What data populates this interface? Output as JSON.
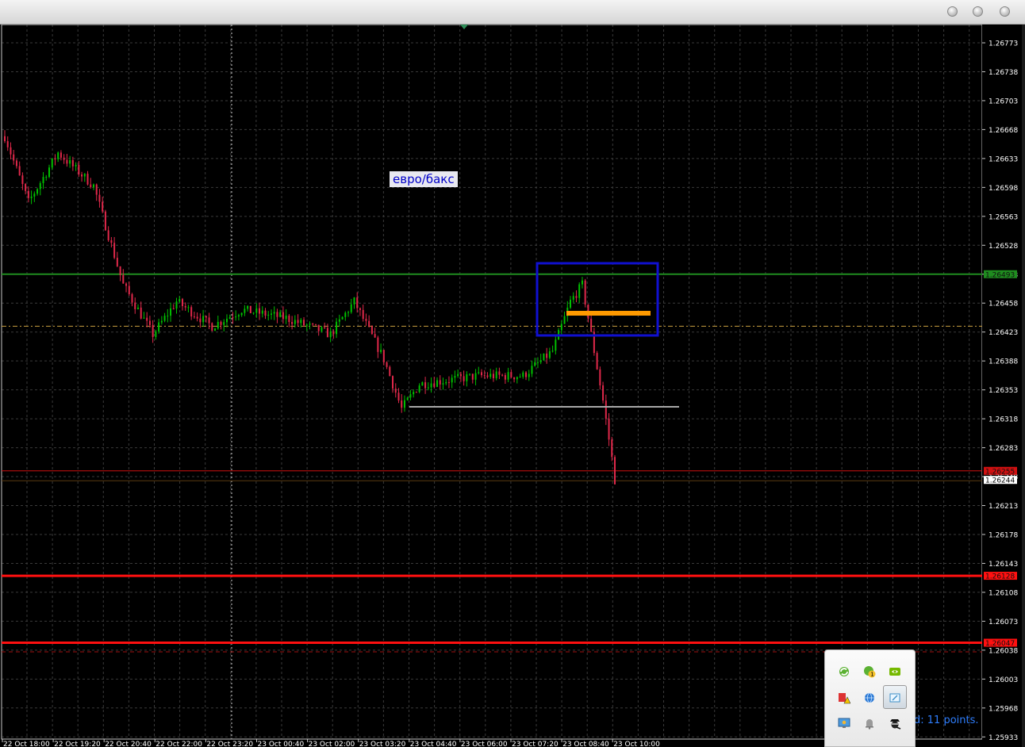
{
  "chart_data": {
    "type": "candlestick",
    "title": "",
    "xlabel": "",
    "ylabel": "",
    "ylim": [
      1.25915,
      1.2679
    ],
    "y_ticks": [
      "1.26773",
      "1.26738",
      "1.26703",
      "1.26668",
      "1.26633",
      "1.26598",
      "1.26563",
      "1.26528",
      "1.26493",
      "1.26458",
      "1.26423",
      "1.26388",
      "1.26353",
      "1.26318",
      "1.26283",
      "1.26248",
      "1.26213",
      "1.26178",
      "1.26143",
      "1.26108",
      "1.26073",
      "1.26038",
      "1.26003",
      "1.25968",
      "1.25933"
    ],
    "x_ticks": [
      "22 Oct 18:00",
      "22 Oct 19:20",
      "22 Oct 20:40",
      "22 Oct 22:00",
      "22 Oct 23:20",
      "23 Oct 00:40",
      "23 Oct 02:00",
      "23 Oct 03:20",
      "23 Oct 04:40",
      "23 Oct 06:00",
      "23 Oct 07:20",
      "23 Oct 08:40",
      "23 Oct 10:00"
    ],
    "series_anchors": [
      {
        "bar": 0,
        "price": 1.2666
      },
      {
        "bar": 8,
        "price": 1.2658
      },
      {
        "bar": 18,
        "price": 1.2664
      },
      {
        "bar": 30,
        "price": 1.266
      },
      {
        "bar": 40,
        "price": 1.2648
      },
      {
        "bar": 50,
        "price": 1.2642
      },
      {
        "bar": 58,
        "price": 1.2646
      },
      {
        "bar": 70,
        "price": 1.2643
      },
      {
        "bar": 80,
        "price": 1.2645
      },
      {
        "bar": 95,
        "price": 1.2644
      },
      {
        "bar": 110,
        "price": 1.2642
      },
      {
        "bar": 118,
        "price": 1.2646
      },
      {
        "bar": 128,
        "price": 1.2639
      },
      {
        "bar": 134,
        "price": 1.2633
      },
      {
        "bar": 140,
        "price": 1.2636
      },
      {
        "bar": 160,
        "price": 1.2637
      },
      {
        "bar": 175,
        "price": 1.2637
      },
      {
        "bar": 185,
        "price": 1.264
      },
      {
        "bar": 191,
        "price": 1.2646
      },
      {
        "bar": 195,
        "price": 1.2648
      },
      {
        "bar": 198,
        "price": 1.2642
      },
      {
        "bar": 202,
        "price": 1.2634
      },
      {
        "bar": 205,
        "price": 1.2627
      },
      {
        "bar": 206,
        "price": 1.26244
      }
    ],
    "levels": [
      {
        "price": 1.26493,
        "color": "#1f8c1f",
        "label": "1.26493",
        "style": "solid"
      },
      {
        "price": 1.2643,
        "color": "#c8a040",
        "label": "",
        "style": "dashdot"
      },
      {
        "price": 1.26255,
        "color": "#d01010",
        "label": "1.26255",
        "style": "solid"
      },
      {
        "price": 1.26128,
        "color": "#ff1010",
        "label": "1.26128",
        "style": "thick"
      },
      {
        "price": 1.26047,
        "color": "#ff1010",
        "label": "1.26047",
        "style": "thick"
      },
      {
        "price": 1.26036,
        "color": "#a01010",
        "label": "",
        "style": "dash"
      }
    ],
    "current_price": {
      "price": 1.26244,
      "label": "1.26244"
    },
    "colors": {
      "up": "#00c000",
      "down": "#e0284a",
      "grid": "#3a3a3a",
      "axis_text": "#ffffff"
    }
  },
  "chart_label": "евро/бакс",
  "status_text": "d: 11 points.",
  "tray_icons": [
    "green-refresh-icon",
    "green-update-badge-icon",
    "nvidia-icon",
    "antivirus-warning-icon",
    "network-globe-icon",
    "display-settings-icon",
    "monitor-settings-icon",
    "notification-bell-icon",
    "spy-agent-icon"
  ]
}
